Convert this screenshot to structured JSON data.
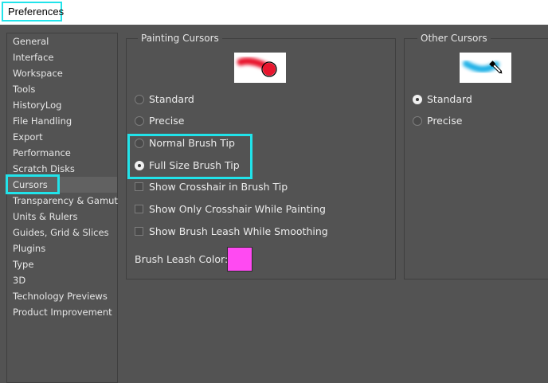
{
  "window": {
    "title": "Preferences"
  },
  "sidebar": {
    "items": [
      {
        "label": "General"
      },
      {
        "label": "Interface"
      },
      {
        "label": "Workspace"
      },
      {
        "label": "Tools"
      },
      {
        "label": "HistoryLog"
      },
      {
        "label": "File Handling"
      },
      {
        "label": "Export"
      },
      {
        "label": "Performance"
      },
      {
        "label": "Scratch Disks"
      },
      {
        "label": "Cursors",
        "selected": true
      },
      {
        "label": "Transparency & Gamut"
      },
      {
        "label": "Units & Rulers"
      },
      {
        "label": "Guides, Grid & Slices"
      },
      {
        "label": "Plugins"
      },
      {
        "label": "Type"
      },
      {
        "label": "3D"
      },
      {
        "label": "Technology Previews"
      },
      {
        "label": "Product Improvement"
      }
    ]
  },
  "painting_cursors": {
    "title": "Painting Cursors",
    "options": [
      {
        "label": "Standard",
        "selected": false
      },
      {
        "label": "Precise",
        "selected": false
      },
      {
        "label": "Normal Brush Tip",
        "selected": false
      },
      {
        "label": "Full Size Brush Tip",
        "selected": true
      }
    ],
    "checkboxes": [
      {
        "label": "Show Crosshair in Brush Tip",
        "checked": false
      },
      {
        "label": "Show Only Crosshair While Painting",
        "checked": false
      },
      {
        "label": "Show Brush Leash While Smoothing",
        "checked": false
      }
    ],
    "leash_color_label": "Brush Leash Color:",
    "leash_color": "#ff4af2"
  },
  "other_cursors": {
    "title": "Other Cursors",
    "options": [
      {
        "label": "Standard",
        "selected": true
      },
      {
        "label": "Precise",
        "selected": false
      }
    ]
  },
  "highlight_color": "#21e3ea"
}
